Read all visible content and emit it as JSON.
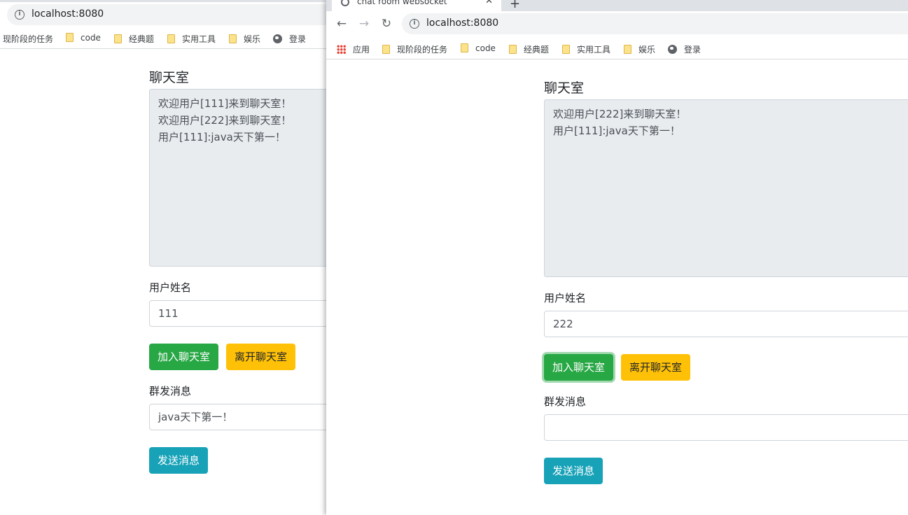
{
  "window_left": {
    "address": "localhost:8080",
    "bookmarks": [
      {
        "label": "现阶段的任务",
        "icon": "folder-icon"
      },
      {
        "label": "code",
        "icon": "folder-icon"
      },
      {
        "label": "经典题",
        "icon": "folder-icon"
      },
      {
        "label": "实用工具",
        "icon": "folder-icon"
      },
      {
        "label": "娱乐",
        "icon": "folder-icon"
      },
      {
        "label": "登录",
        "icon": "globe-icon"
      }
    ],
    "chat": {
      "title": "聊天室",
      "messages": [
        "欢迎用户[111]来到聊天室！",
        "欢迎用户[222]来到聊天室！",
        "用户[111]:java天下第一！"
      ],
      "username_label": "用户姓名",
      "username_value": "111",
      "join_label": "加入聊天室",
      "leave_label": "离开聊天室",
      "broadcast_label": "群发消息",
      "broadcast_value": "java天下第一！",
      "send_label": "发送消息"
    }
  },
  "window_right": {
    "tab_title": "chat room websocket",
    "new_tab_label": "+",
    "address": "localhost:8080",
    "bookmarks": [
      {
        "label": "应用",
        "icon": "apps-icon"
      },
      {
        "label": "现阶段的任务",
        "icon": "folder-icon"
      },
      {
        "label": "code",
        "icon": "folder-icon"
      },
      {
        "label": "经典题",
        "icon": "folder-icon"
      },
      {
        "label": "实用工具",
        "icon": "folder-icon"
      },
      {
        "label": "娱乐",
        "icon": "folder-icon"
      },
      {
        "label": "登录",
        "icon": "globe-icon"
      }
    ],
    "chat": {
      "title": "聊天室",
      "messages": [
        "欢迎用户[222]来到聊天室！",
        "用户[111]:java天下第一！"
      ],
      "username_label": "用户姓名",
      "username_value": "222",
      "join_label": "加入聊天室",
      "leave_label": "离开聊天室",
      "broadcast_label": "群发消息",
      "broadcast_value": "",
      "send_label": "发送消息"
    }
  },
  "colors": {
    "success": "#28a745",
    "warning": "#ffc107",
    "info": "#17a2b8",
    "readonly_bg": "#e9ecef"
  }
}
